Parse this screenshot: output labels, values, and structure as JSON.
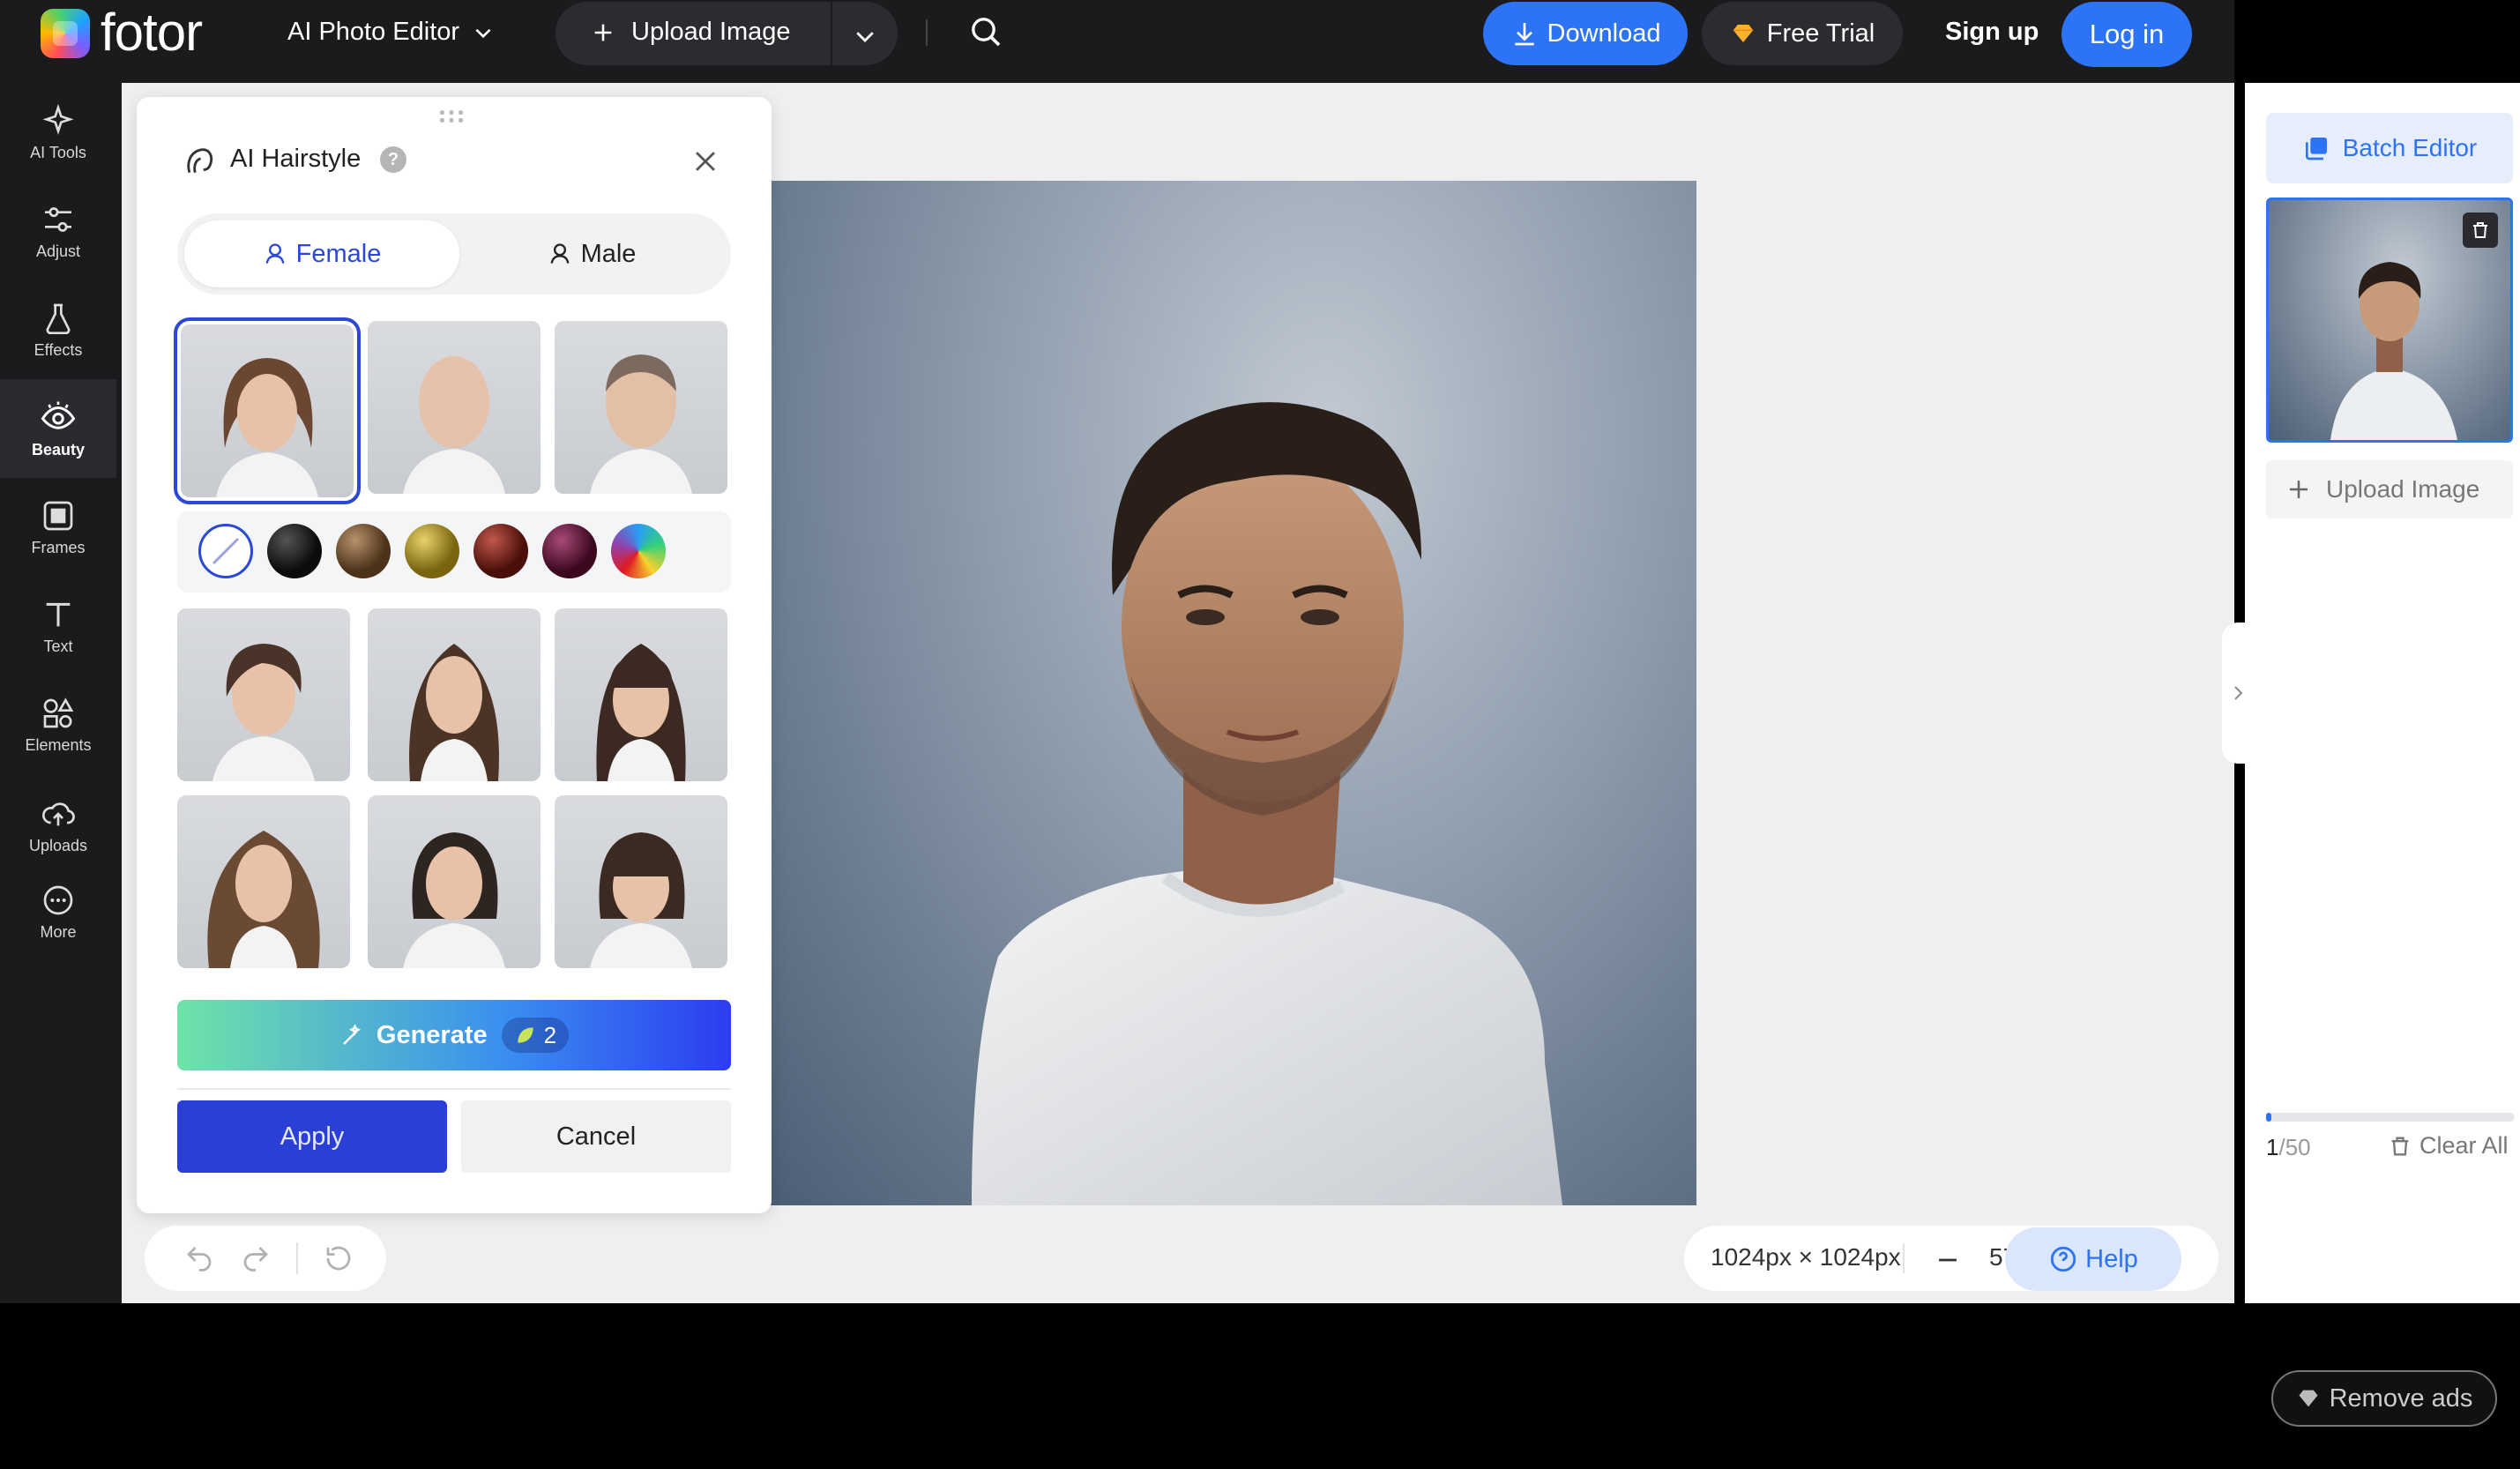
{
  "topbar": {
    "logo": "fotor",
    "menu": "AI Photo Editor",
    "upload": "Upload Image",
    "download": "Download",
    "free_trial": "Free Trial",
    "sign_up": "Sign up",
    "log_in": "Log in"
  },
  "sidebar": {
    "items": [
      {
        "label": "AI Tools",
        "icon": "sparkle-icon"
      },
      {
        "label": "Adjust",
        "icon": "sliders-icon"
      },
      {
        "label": "Effects",
        "icon": "flask-icon"
      },
      {
        "label": "Beauty",
        "icon": "eye-icon"
      },
      {
        "label": "Frames",
        "icon": "frame-icon"
      },
      {
        "label": "Text",
        "icon": "text-icon"
      },
      {
        "label": "Elements",
        "icon": "shapes-icon"
      },
      {
        "label": "Uploads",
        "icon": "cloud-upload-icon"
      },
      {
        "label": "More",
        "icon": "more-icon"
      }
    ],
    "active": "Beauty"
  },
  "panel": {
    "title": "AI Hairstyle",
    "gender_female": "Female",
    "gender_male": "Male",
    "generate": "Generate",
    "credits": "2",
    "apply": "Apply",
    "cancel": "Cancel"
  },
  "colors": {
    "swatches": [
      "none",
      "#151517",
      "#6b4b28",
      "#a88d1c",
      "#6e1b14",
      "#5c0f2a",
      "rainbow"
    ],
    "accent": "#2c73f5",
    "apply": "#2a3fd6"
  },
  "canvas": {
    "size": "1024px × 1024px",
    "zoom": "57",
    "help": "Help"
  },
  "right": {
    "batch": "Batch Editor",
    "upload": "Upload Image",
    "count_current": "1",
    "count_total": "/50",
    "clear": "Clear All",
    "progress": 0.02
  },
  "footer": {
    "remove_ads": "Remove ads"
  }
}
